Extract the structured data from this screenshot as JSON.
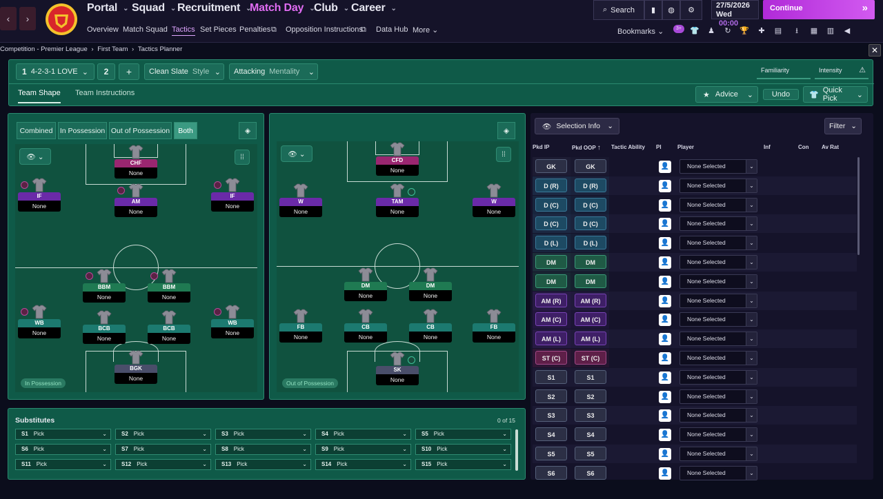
{
  "nav": {
    "back": "‹",
    "forward": "›",
    "menus": [
      "Portal",
      "Squad",
      "Recruitment",
      "Match Day",
      "Club",
      "Career"
    ],
    "submenu": [
      "Overview",
      "Match Squad",
      "Tactics",
      "Set Pieces",
      "Penalties",
      "Opposition Instructions",
      "Data Hub",
      "More"
    ],
    "search": "Search",
    "date": "27/5/2026",
    "day": "Wed",
    "time": "00:00",
    "continue": "Continue",
    "bookmarks": "Bookmarks",
    "notif": "3+"
  },
  "breadcrumb": [
    "Competition - Premier League",
    "First Team",
    "Tactics Planner"
  ],
  "tactic": {
    "slot1_num": "1",
    "slot1_name": "4-2-3-1 LOVE",
    "slot2_num": "2",
    "add": "+",
    "style_value": "Clean Slate",
    "style_label": "Style",
    "mentality_value": "Attacking",
    "mentality_label": "Mentality",
    "familiarity": "Familiarity",
    "intensity": "Intensity",
    "tabs": [
      "Team Shape",
      "Team Instructions"
    ],
    "advice": "Advice",
    "undo": "Undo",
    "quickpick": "Quick Pick"
  },
  "pitch_toggles": [
    "Combined",
    "In Possession",
    "Out of Possession",
    "Both"
  ],
  "in_possession": {
    "status": "In Possession",
    "none": "None",
    "players": [
      {
        "role": "CHF"
      },
      {
        "role": "IF"
      },
      {
        "role": "AM"
      },
      {
        "role": "IF"
      },
      {
        "role": "BBM"
      },
      {
        "role": "BBM"
      },
      {
        "role": "WB"
      },
      {
        "role": "BCB"
      },
      {
        "role": "BCB"
      },
      {
        "role": "WB"
      },
      {
        "role": "BGK"
      }
    ]
  },
  "out_possession": {
    "status": "Out of Possession",
    "none": "None",
    "players": [
      {
        "role": "CFD"
      },
      {
        "role": "W"
      },
      {
        "role": "TAM"
      },
      {
        "role": "W"
      },
      {
        "role": "DM"
      },
      {
        "role": "DM"
      },
      {
        "role": "FB"
      },
      {
        "role": "CB"
      },
      {
        "role": "CB"
      },
      {
        "role": "FB"
      },
      {
        "role": "SK"
      }
    ]
  },
  "substitutes": {
    "title": "Substitutes",
    "count": "0 of 15",
    "pick": "Pick",
    "slots": [
      "S1",
      "S2",
      "S3",
      "S4",
      "S5",
      "S6",
      "S7",
      "S8",
      "S9",
      "S10",
      "S11",
      "S12",
      "S13",
      "S14",
      "S15"
    ]
  },
  "selection": {
    "info": "Selection Info",
    "filter": "Filter",
    "columns": [
      "Pkd IP",
      "Pkd OOP",
      "Tactic Ability",
      "PI",
      "Player",
      "Inf",
      "Con",
      "Av Rat"
    ],
    "none_selected": "None Selected",
    "rows": [
      {
        "ip": "GK",
        "oop": "GK"
      },
      {
        "ip": "D (R)",
        "oop": "D (R)"
      },
      {
        "ip": "D (C)",
        "oop": "D (C)"
      },
      {
        "ip": "D (C)",
        "oop": "D (C)"
      },
      {
        "ip": "D (L)",
        "oop": "D (L)"
      },
      {
        "ip": "DM",
        "oop": "DM"
      },
      {
        "ip": "DM",
        "oop": "DM"
      },
      {
        "ip": "AM (R)",
        "oop": "AM (R)"
      },
      {
        "ip": "AM (C)",
        "oop": "AM (C)"
      },
      {
        "ip": "AM (L)",
        "oop": "AM (L)"
      },
      {
        "ip": "ST (C)",
        "oop": "ST (C)"
      },
      {
        "ip": "S1",
        "oop": "S1"
      },
      {
        "ip": "S2",
        "oop": "S2"
      },
      {
        "ip": "S3",
        "oop": "S3"
      },
      {
        "ip": "S4",
        "oop": "S4"
      },
      {
        "ip": "S5",
        "oop": "S5"
      },
      {
        "ip": "S6",
        "oop": "S6"
      }
    ]
  },
  "colors": {
    "gk": "#2c2f45",
    "def": "#1f4f6a",
    "dm": "#1f6b4a",
    "am": "#3e1f66",
    "st": "#6a1f4a",
    "sub": "#2c2f45",
    "accent": "#c93ee6"
  }
}
